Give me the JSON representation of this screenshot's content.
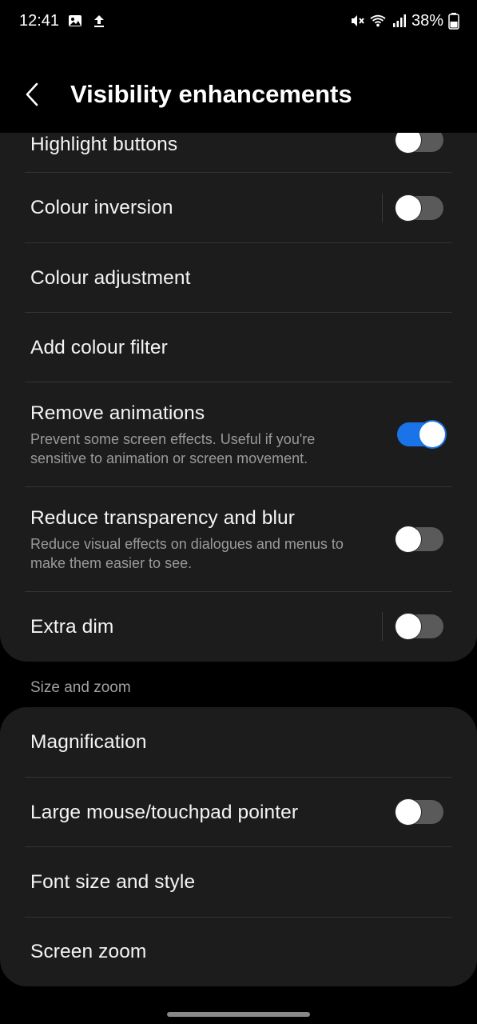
{
  "status_bar": {
    "time": "12:41",
    "battery": "38%",
    "left_icons": [
      "gallery-icon",
      "upload-icon"
    ],
    "right_icons": [
      "mute-icon",
      "wifi-icon",
      "signal-icon",
      "battery-icon"
    ]
  },
  "header": {
    "title": "Visibility enhancements"
  },
  "visibility_settings": [
    {
      "title": "Highlight buttons",
      "toggle": false
    },
    {
      "title": "Colour inversion",
      "toggle": false
    },
    {
      "title": "Colour adjustment"
    },
    {
      "title": "Add colour filter"
    },
    {
      "title": "Remove animations",
      "subtitle": "Prevent some screen effects. Useful if you're sensitive to animation or screen movement.",
      "toggle": true
    },
    {
      "title": "Reduce transparency and blur",
      "subtitle": "Reduce visual effects on dialogues and menus to make them easier to see.",
      "toggle": false
    },
    {
      "title": "Extra dim",
      "toggle": false
    }
  ],
  "size_zoom": {
    "section_label": "Size and zoom",
    "items": [
      {
        "title": "Magnification"
      },
      {
        "title": "Large mouse/touchpad pointer",
        "toggle": false
      },
      {
        "title": "Font size and style"
      },
      {
        "title": "Screen zoom"
      }
    ]
  },
  "colors": {
    "toggle_on": "#1a73e8",
    "toggle_off": "#5a5a5a",
    "card_bg": "#1c1c1c"
  }
}
